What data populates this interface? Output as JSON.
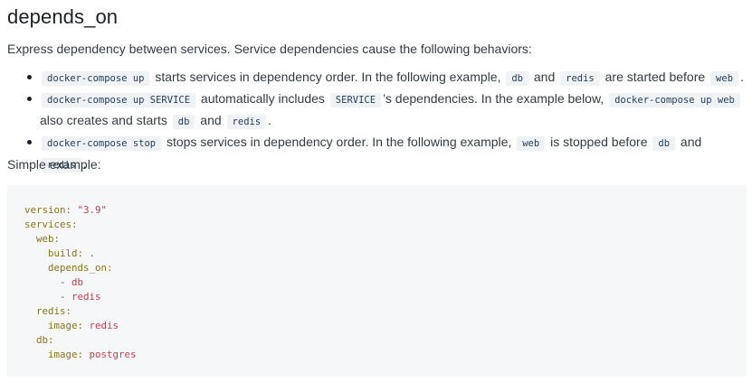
{
  "heading": "depends_on",
  "intro": "Express dependency between services. Service dependencies cause the following behaviors:",
  "bullets": [
    {
      "parts": [
        {
          "code": "docker-compose up"
        },
        {
          "text": " starts services in dependency order. In the following example, "
        },
        {
          "code": "db"
        },
        {
          "text": " and "
        },
        {
          "code": "redis"
        },
        {
          "text": " are started before "
        },
        {
          "code": "web"
        },
        {
          "text": "."
        }
      ]
    },
    {
      "parts": [
        {
          "code": "docker-compose up SERVICE"
        },
        {
          "text": " automatically includes "
        },
        {
          "code": "SERVICE"
        },
        {
          "text": "’s dependencies. In the example below, "
        },
        {
          "code": "docker-compose up web"
        },
        {
          "text": " also creates and starts "
        },
        {
          "code": "db"
        },
        {
          "text": " and "
        },
        {
          "code": "redis"
        },
        {
          "text": "."
        }
      ]
    },
    {
      "parts": [
        {
          "code": "docker-compose stop"
        },
        {
          "text": " stops services in dependency order. In the following example, "
        },
        {
          "code": "web"
        },
        {
          "text": " is stopped before "
        },
        {
          "code": "db"
        },
        {
          "text": " and "
        },
        {
          "code": "redis"
        },
        {
          "text": "."
        }
      ]
    }
  ],
  "simple_label": "Simple example:",
  "code_lines": [
    [
      {
        "k": "version:"
      },
      {
        "p": " "
      },
      {
        "s": "\"3.9\""
      }
    ],
    [
      {
        "k": "services:"
      }
    ],
    [
      {
        "p": "  "
      },
      {
        "k": "web:"
      }
    ],
    [
      {
        "p": "    "
      },
      {
        "k": "build:"
      },
      {
        "p": " ."
      }
    ],
    [
      {
        "p": "    "
      },
      {
        "k": "depends_on:"
      }
    ],
    [
      {
        "p": "      - "
      },
      {
        "s": "db"
      }
    ],
    [
      {
        "p": "      - "
      },
      {
        "s": "redis"
      }
    ],
    [
      {
        "p": "  "
      },
      {
        "k": "redis:"
      }
    ],
    [
      {
        "p": "    "
      },
      {
        "k": "image:"
      },
      {
        "p": " "
      },
      {
        "s": "redis"
      }
    ],
    [
      {
        "p": "  "
      },
      {
        "k": "db:"
      }
    ],
    [
      {
        "p": "    "
      },
      {
        "k": "image:"
      },
      {
        "p": " "
      },
      {
        "s": "postgres"
      }
    ]
  ]
}
